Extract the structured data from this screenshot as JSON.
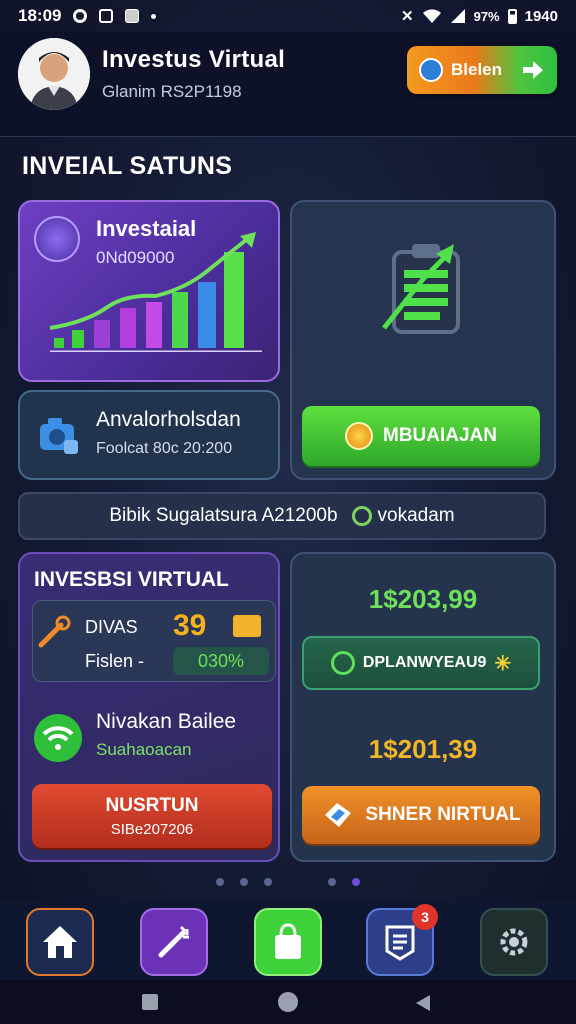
{
  "status_bar": {
    "time": "18:09",
    "right_text": "1940",
    "signal_text": "97%"
  },
  "header": {
    "title": "Investus Virtual",
    "subtitle": "Glanim RS2P1198",
    "action_button_label": "Blelen"
  },
  "section_title": "INVEIAL SATUNS",
  "invest_card": {
    "title": "Investaial",
    "subtitle": "0Nd09000"
  },
  "analytics_card": {
    "title": "Anvalorholsdan",
    "subtitle": "Foolcat 80c 20:200"
  },
  "primary_button_label": "MBUAIAJAN",
  "banner": {
    "text": "Bibik Sugalatsura A21200b",
    "action_label": "vokadam"
  },
  "invest_virtual": {
    "title": "INVESBSI VIRTUAL",
    "item1": {
      "label": "DIVAS",
      "value": "39",
      "sub_label": "Fislen -",
      "percent": "030%"
    },
    "item2": {
      "title": "Nivakan Bailee",
      "subtitle": "Suahaoacan"
    },
    "button": {
      "label": "NUSRTUN",
      "sub_label": "SIBe207206"
    }
  },
  "right_panel": {
    "amount1": "1$203,99",
    "button1_label": "DPLANWYEAU9",
    "amount2": "1$201,39",
    "button2_label": "SHNER NIRTUAL"
  },
  "bottom_nav": {
    "badge_count": "3"
  },
  "colors": {
    "green": "#3fd13a",
    "purple": "#6e3fc4",
    "orange": "#f19127",
    "red": "#d2402a"
  }
}
